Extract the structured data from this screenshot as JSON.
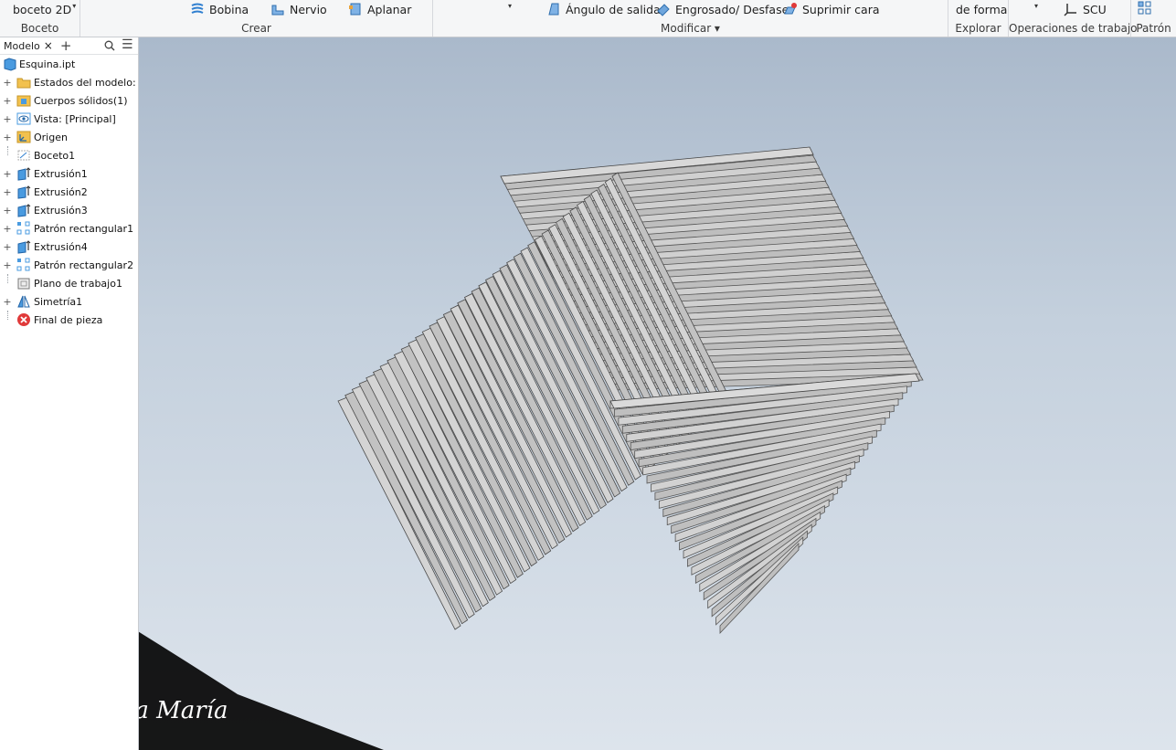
{
  "ribbon": {
    "boceto": {
      "label": "Boceto",
      "button": "boceto 2D"
    },
    "crear": {
      "label": "Crear",
      "bobina": "Bobina",
      "nervio": "Nervio",
      "aplanar": "Aplanar"
    },
    "modificar": {
      "label": "Modificar ▾",
      "angulo": "Ángulo de salida",
      "engrosado": "Engrosado/ Desfase",
      "suprimir": "Suprimir cara"
    },
    "explorar": {
      "label": "Explorar",
      "button": "de forma"
    },
    "operaciones": {
      "label": "Operaciones de trabajo",
      "scu": "SCU"
    },
    "patron": {
      "label": "Patrón"
    }
  },
  "browser": {
    "tab_label": "Modelo",
    "root": "Esquina.ipt",
    "items": [
      {
        "label": "Estados del modelo: [Pri",
        "icon": "folder-icon",
        "expandable": true
      },
      {
        "label": "Cuerpos sólidos(1)",
        "icon": "solid-bodies-icon",
        "expandable": true
      },
      {
        "label": "Vista: [Principal]",
        "icon": "view-icon",
        "expandable": true
      },
      {
        "label": "Origen",
        "icon": "origin-icon",
        "expandable": true
      },
      {
        "label": "Boceto1",
        "icon": "sketch-icon",
        "expandable": false
      },
      {
        "label": "Extrusión1",
        "icon": "extrude-icon",
        "expandable": true
      },
      {
        "label": "Extrusión2",
        "icon": "extrude-icon",
        "expandable": true
      },
      {
        "label": "Extrusión3",
        "icon": "extrude-icon",
        "expandable": true
      },
      {
        "label": "Patrón rectangular1",
        "icon": "pattern-icon",
        "expandable": true
      },
      {
        "label": "Extrusión4",
        "icon": "extrude-icon",
        "expandable": true
      },
      {
        "label": "Patrón rectangular2",
        "icon": "pattern-icon",
        "expandable": true
      },
      {
        "label": "Plano de trabajo1",
        "icon": "work-plane-icon",
        "expandable": false
      },
      {
        "label": "Simetría1",
        "icon": "mirror-icon",
        "expandable": true
      },
      {
        "label": "Final de pieza",
        "icon": "end-of-part-icon",
        "expandable": false
      }
    ]
  },
  "watermark": {
    "text": "Lina María"
  },
  "colors": {
    "accent": "#3a8fd8",
    "viewport_top": "#aab9cb",
    "viewport_bottom": "#dde4ec",
    "fin_face": "#c9c9c9",
    "watermark_red": "#e8432b"
  }
}
